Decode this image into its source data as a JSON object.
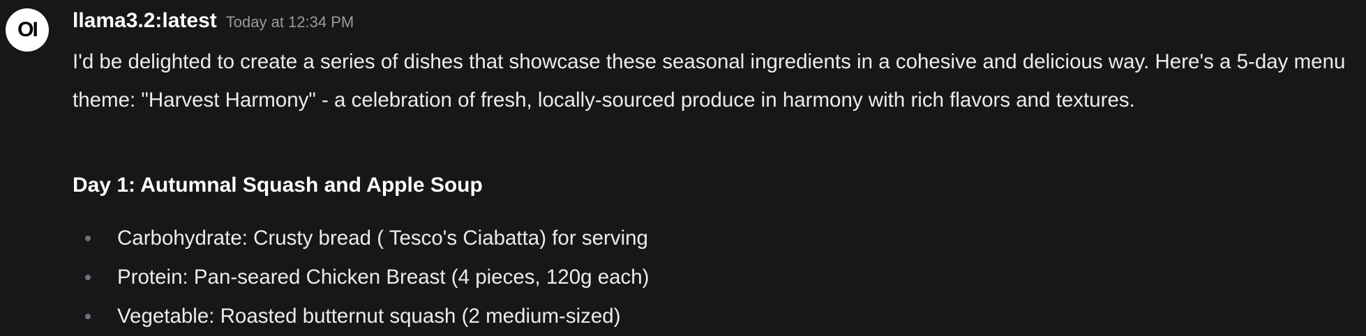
{
  "avatar": {
    "glyph": "OI"
  },
  "message": {
    "model_name": "llama3.2:latest",
    "timestamp": "Today at 12:34 PM",
    "intro": "I'd be delighted to create a series of dishes that showcase these seasonal ingredients in a cohesive and delicious way. Here's a 5-day menu theme: \"Harvest Harmony\" - a celebration of fresh, locally-sourced produce in harmony with rich flavors and textures.",
    "day_heading": "Day 1: Autumnal Squash and Apple Soup",
    "items": [
      "Carbohydrate: Crusty bread ( Tesco's Ciabatta) for serving",
      "Protein: Pan-seared Chicken Breast (4 pieces, 120g each)",
      "Vegetable: Roasted butternut squash (2 medium-sized)"
    ]
  },
  "colors": {
    "background": "#171717",
    "text": "#ececec",
    "muted": "#9b9b9b",
    "bullet": "#6b7280"
  }
}
